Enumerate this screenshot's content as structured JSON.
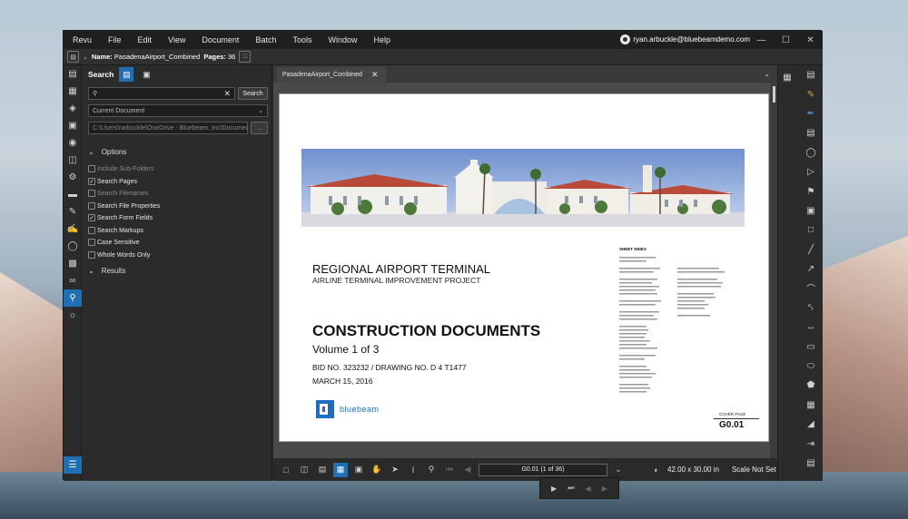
{
  "menu": [
    "Revu",
    "File",
    "Edit",
    "View",
    "Document",
    "Batch",
    "Tools",
    "Window",
    "Help"
  ],
  "user": "ryan.arbuckle@bluebeamdemo.com",
  "docbar": {
    "name_label": "Name:",
    "name_value": "PasadenaAirport_Combined",
    "pages_label": "Pages:",
    "pages_value": "36"
  },
  "search": {
    "title": "Search",
    "query": "",
    "search_button": "Search",
    "scope": "Current Document",
    "path": "C:\\Users\\rarbuckle\\OneDrive - Bluebeam, Inc\\Documen",
    "browse_button": "...",
    "options_label": "Options",
    "options": [
      {
        "label": "Include Sub-Folders",
        "checked": false,
        "enabled": false
      },
      {
        "label": "Search Pages",
        "checked": true,
        "enabled": true
      },
      {
        "label": "Search Filenames",
        "checked": false,
        "enabled": false
      },
      {
        "label": "Search File Properties",
        "checked": false,
        "enabled": true
      },
      {
        "label": "Search Form Fields",
        "checked": true,
        "enabled": true
      },
      {
        "label": "Search Markups",
        "checked": false,
        "enabled": true
      },
      {
        "label": "Case Sensitive",
        "checked": false,
        "enabled": true
      },
      {
        "label": "Whole Words Only",
        "checked": false,
        "enabled": true
      }
    ],
    "results_label": "Results"
  },
  "doc_tab": "PasadenaAirport_Combined",
  "drawing": {
    "title": "REGIONAL AIRPORT TERMINAL",
    "subtitle": "AIRLINE TERMINAL IMPROVEMENT PROJECT",
    "heading": "CONSTRUCTION DOCUMENTS",
    "volume": "Volume 1 of 3",
    "bid": "BID NO. 323232 /  DRAWING NO. D 4 T1477",
    "date": "MARCH 15, 2016",
    "logo_text": "bluebeam",
    "sheet_index": "SHEET INDEX",
    "sheet_label": "COVER PAGE",
    "sheet_number": "G0.01"
  },
  "status": {
    "page": "G0.01 (1 of 36)",
    "size": "42.00 x 30.00 in",
    "scale": "Scale Not Set"
  },
  "colors": {
    "accent": "#1f6fb5",
    "bluebeam": "#1a6fc4"
  }
}
